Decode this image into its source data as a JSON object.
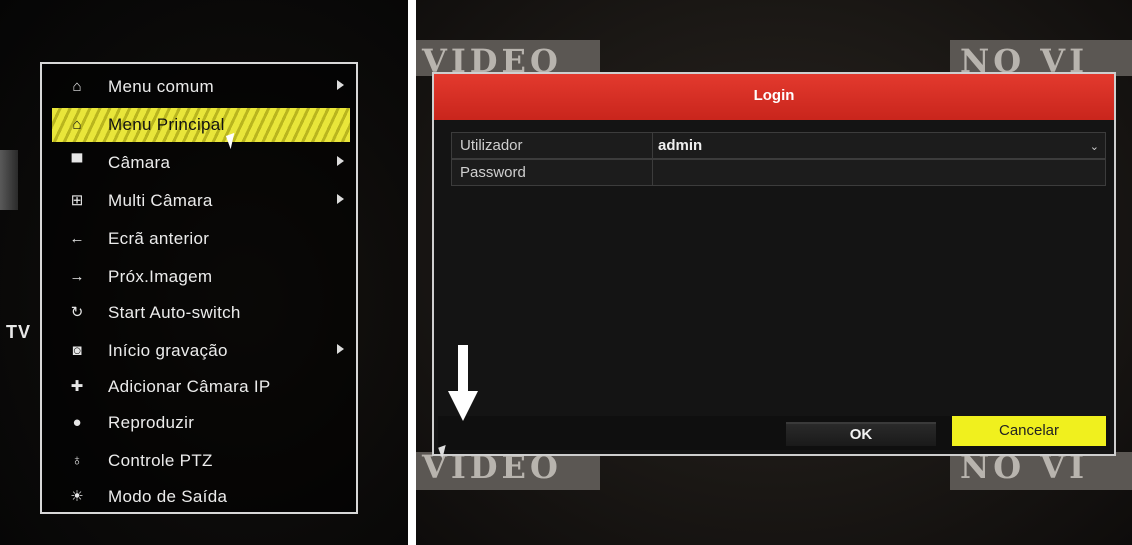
{
  "context_menu": {
    "items": [
      {
        "label": "Menu comum",
        "icon": "home-star-icon",
        "glyph": "⌂",
        "submenu": true,
        "selected": false
      },
      {
        "label": "Menu Principal",
        "icon": "home-icon",
        "glyph": "⌂",
        "submenu": false,
        "selected": true
      },
      {
        "label": "Câmara",
        "icon": "camera-icon",
        "glyph": "▀",
        "submenu": true,
        "selected": false
      },
      {
        "label": "Multi Câmara",
        "icon": "multi-camera-icon",
        "glyph": "⊞",
        "submenu": true,
        "selected": false
      },
      {
        "label": "Ecrã anterior",
        "icon": "arrow-left-icon",
        "glyph": "←",
        "submenu": false,
        "selected": false
      },
      {
        "label": "Próx.Imagem",
        "icon": "arrow-right-icon",
        "glyph": "→",
        "submenu": false,
        "selected": false
      },
      {
        "label": "Start Auto-switch",
        "icon": "refresh-icon",
        "glyph": "↻",
        "submenu": false,
        "selected": false
      },
      {
        "label": "Início gravação",
        "icon": "record-icon",
        "glyph": "◙",
        "submenu": true,
        "selected": false
      },
      {
        "label": "Adicionar Câmara IP",
        "icon": "add-ip-camera-icon",
        "glyph": "✚",
        "submenu": false,
        "selected": false
      },
      {
        "label": "Reproduzir",
        "icon": "playback-icon",
        "glyph": "●",
        "submenu": false,
        "selected": false
      },
      {
        "label": "Controle PTZ",
        "icon": "ptz-icon",
        "glyph": "♁",
        "submenu": false,
        "selected": false
      },
      {
        "label": "Modo de Saída",
        "icon": "output-mode-icon",
        "glyph": "☀",
        "submenu": false,
        "selected": false
      }
    ]
  },
  "left_background": {
    "tv_text": "TV"
  },
  "right_background": {
    "tile_text_left": "VIDEO",
    "tile_text_right": "NO VI"
  },
  "login": {
    "title": "Login",
    "user_label": "Utilizador",
    "user_value": "admin",
    "password_label": "Password",
    "password_value": "",
    "ok_label": "OK",
    "cancel_label": "Cancelar"
  },
  "colors": {
    "title_bar": "#d92e24",
    "selected_item": "#e9e63a",
    "cancel_button": "#f0f01e"
  }
}
